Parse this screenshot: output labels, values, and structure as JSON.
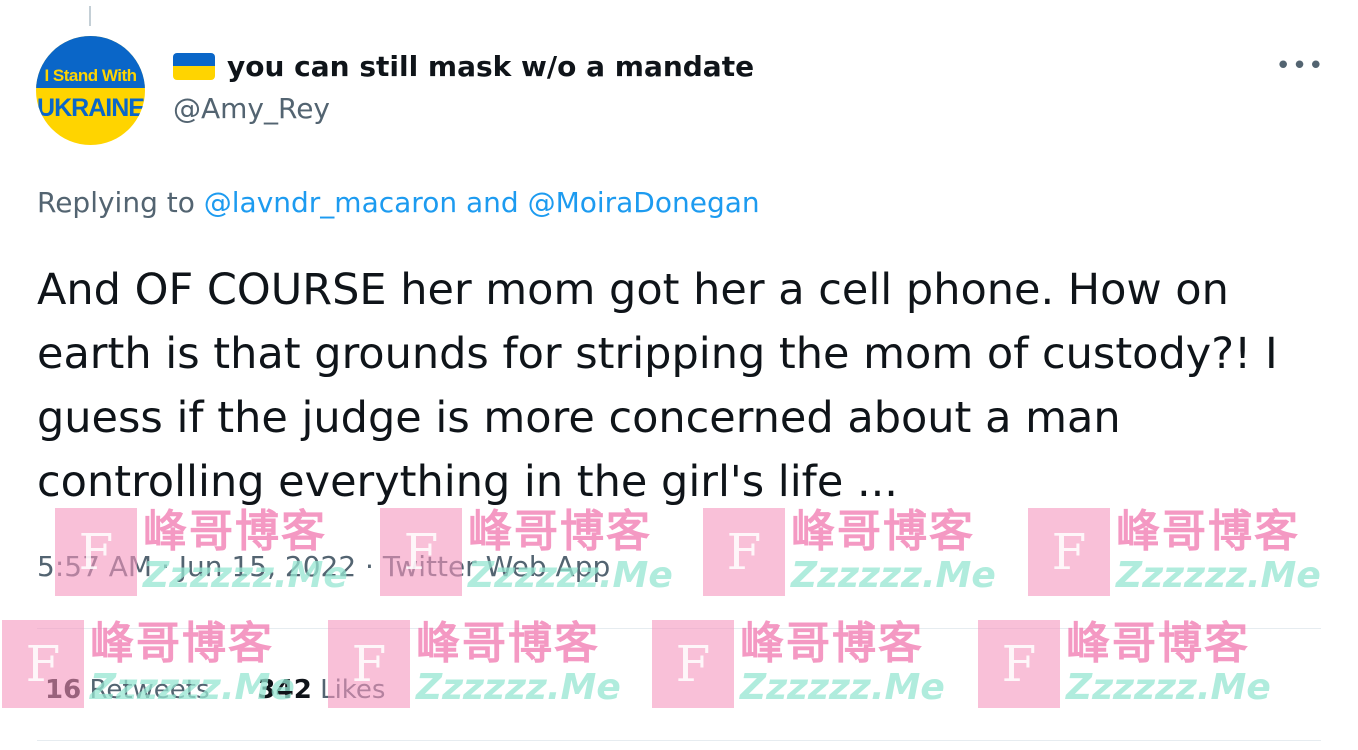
{
  "tweet": {
    "avatar": {
      "line1": "I Stand With",
      "line2": "UKRAINE"
    },
    "flag_icon": "ukraine-flag-icon",
    "display_name": "you can still mask w/o a mandate",
    "handle": "@Amy_Rey",
    "more_label": "•••",
    "reply": {
      "prefix": "Replying to ",
      "mention1": "@lavndr_macaron",
      "joiner": " and ",
      "mention2": "@MoiraDonegan"
    },
    "text": "And OF COURSE her mom got her a cell phone. How on earth is that grounds for stripping the mom of custody?! I guess if the judge is more concerned about a man controlling everything in the girl's life ...",
    "time": "5:57 AM",
    "date": "Jun 15, 2022",
    "source": "Twitter Web App",
    "separator": " · ",
    "stats": {
      "retweets_count": "16",
      "retweets_label": "Retweets",
      "likes_count": "342",
      "likes_label": "Likes"
    }
  },
  "watermark": {
    "logo_letter": "F",
    "cn": "峰哥博客",
    "en": "Zzzzzz.Me"
  },
  "colors": {
    "link": "#1d9bf0",
    "secondary": "#536471",
    "primary": "#0f1419"
  }
}
